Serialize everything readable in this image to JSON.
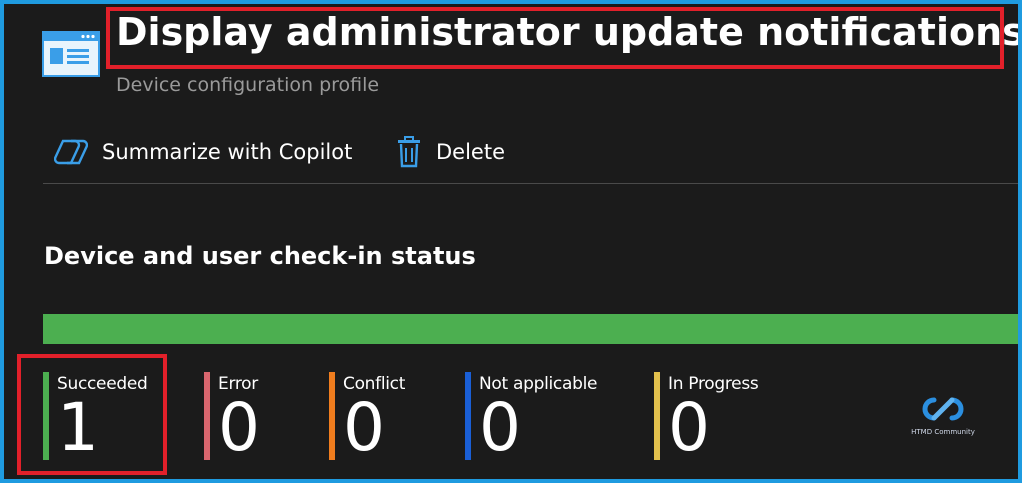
{
  "header": {
    "title": "Display administrator update notifications",
    "subtitle": "Device configuration profile",
    "icon": "profile-window-icon"
  },
  "toolbar": {
    "summarize_label": "Summarize with Copilot",
    "summarize_icon": "copilot-icon",
    "delete_label": "Delete",
    "delete_icon": "trash-icon"
  },
  "section": {
    "title": "Device and user check-in status"
  },
  "status_bar": {
    "color": "#4caf50",
    "succeeded_fraction": 1.0
  },
  "stats": [
    {
      "label": "Succeeded",
      "value": "1",
      "color": "#4caf50"
    },
    {
      "label": "Error",
      "value": "0",
      "color": "#d9666e"
    },
    {
      "label": "Conflict",
      "value": "0",
      "color": "#f07d1e"
    },
    {
      "label": "Not applicable",
      "value": "0",
      "color": "#1a5fd6"
    },
    {
      "label": "In Progress",
      "value": "0",
      "color": "#e3c14d"
    }
  ],
  "brand": {
    "text": "HTMD Community",
    "icon": "htmd-logo-icon"
  },
  "colors": {
    "background": "#1b1b1b",
    "frame_border": "#1f9be0",
    "highlight": "#e2202a",
    "accent_icon": "#3a9ee8"
  }
}
